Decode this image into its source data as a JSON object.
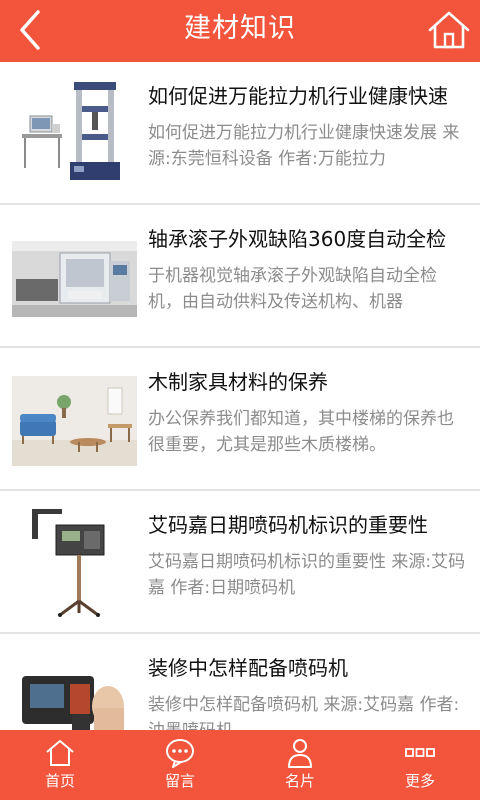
{
  "header": {
    "title": "建材知识",
    "back_icon": "back-arrow-icon",
    "home_icon": "home-icon",
    "bg_color": "#f2543c"
  },
  "articles": [
    {
      "title": "如何促进万能拉力机行业健康快速",
      "desc": "如何促进万能拉力机行业健康快速发展 来源:东莞恒科设备 作者:万能拉力"
    },
    {
      "title": "轴承滚子外观缺陷360度自动全检",
      "desc": "于机器视觉轴承滚子外观缺陷自动全检机，由自动供料及传送机构、机器"
    },
    {
      "title": "木制家具材料的保养",
      "desc": "办公保养我们都知道，其中楼梯的保养也很重要，尤其是那些木质楼梯。"
    },
    {
      "title": "艾码嘉日期喷码机标识的重要性",
      "desc": "艾码嘉日期喷码机标识的重要性 来源:艾码嘉 作者:日期喷码机"
    },
    {
      "title": "装修中怎样配备喷码机",
      "desc": "装修中怎样配备喷码机 来源:艾码嘉 作者:油墨喷码机"
    }
  ],
  "tabbar": {
    "items": [
      {
        "label": "首页",
        "icon": "home-icon"
      },
      {
        "label": "留言",
        "icon": "message-icon"
      },
      {
        "label": "名片",
        "icon": "person-icon"
      },
      {
        "label": "更多",
        "icon": "more-icon"
      }
    ]
  }
}
